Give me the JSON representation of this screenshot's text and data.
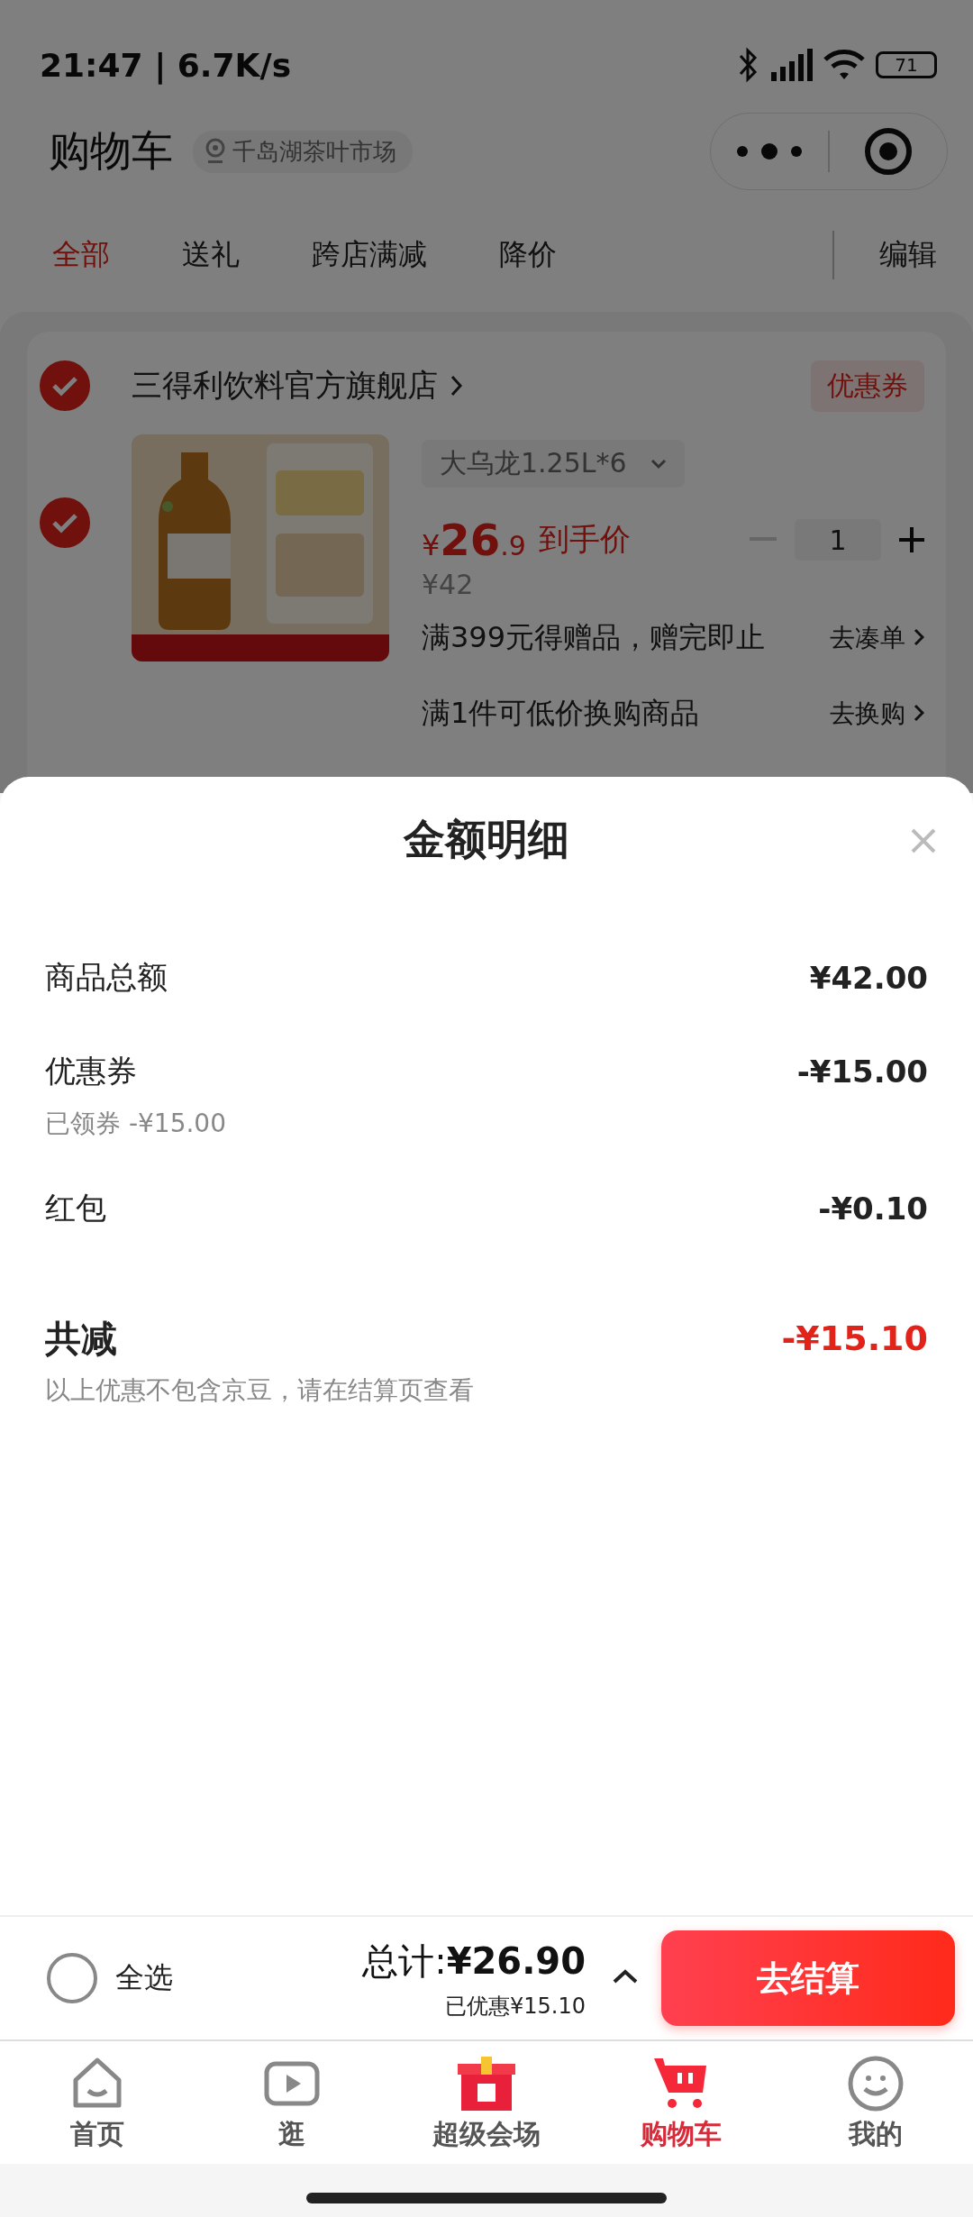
{
  "status_bar": {
    "time": "21:47 | 6.7K/s",
    "battery": "71"
  },
  "header": {
    "title": "购物车",
    "location": "千岛湖茶叶市场"
  },
  "filter_tabs": [
    {
      "label": "全部",
      "selected": true
    },
    {
      "label": "送礼",
      "selected": false
    },
    {
      "label": "跨店满减",
      "selected": false
    },
    {
      "label": "降价",
      "selected": false
    }
  ],
  "edit": "编辑",
  "store": {
    "checked": true,
    "name": "三得利饮料官方旗舰店",
    "coupon": "优惠券"
  },
  "item": {
    "checked": true,
    "spec": "大乌龙1.25L*6",
    "currency": "¥",
    "price_int": "26",
    "price_dec": ".9",
    "price_label": "到手价",
    "original_price": "¥42",
    "quantity": "1"
  },
  "promos": [
    {
      "text": "满399元得赠品，赠完即止",
      "action": "去凑单"
    },
    {
      "text": "满1件可低价换购商品",
      "action": "去换购"
    }
  ],
  "sheet": {
    "title": "金额明细",
    "rows": [
      {
        "kind": "normal",
        "label": "商品总额",
        "value": "¥42.00"
      },
      {
        "kind": "normal",
        "label": "优惠券",
        "value": "-¥15.00",
        "note": "已领券 -¥15.00"
      },
      {
        "kind": "normal",
        "label": "红包",
        "value": "-¥0.10"
      },
      {
        "kind": "total",
        "label": "共减",
        "value": "-¥15.10",
        "note": "以上优惠不包含京豆，请在结算页查看"
      }
    ]
  },
  "checkout": {
    "select_all": {
      "label": "全选",
      "checked": false
    },
    "total": "总计:**¥26.90**",
    "saved": "已优惠¥15.10",
    "button": "去结算"
  },
  "nav": [
    {
      "label": "首页",
      "selected": false
    },
    {
      "label": "逛",
      "selected": false
    },
    {
      "label": "超级会场",
      "selected": false
    },
    {
      "label": "购物车",
      "selected": true
    },
    {
      "label": "我的",
      "selected": false
    }
  ]
}
